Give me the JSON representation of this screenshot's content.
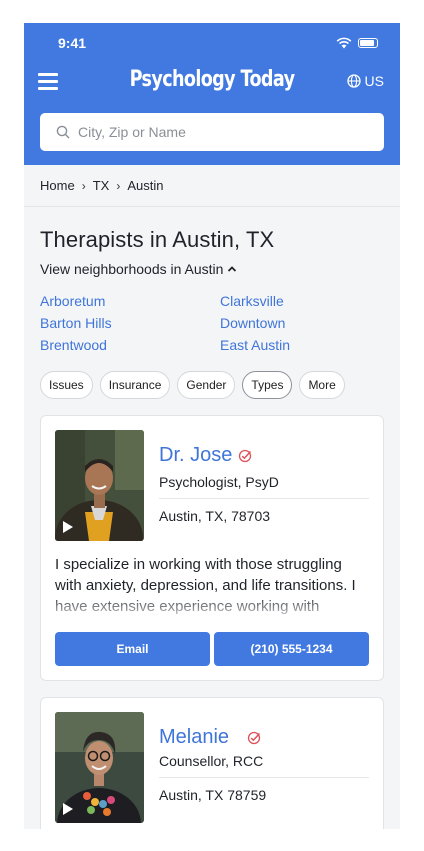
{
  "status_bar": {
    "time": "9:41"
  },
  "header": {
    "logo": "Psychology Today",
    "locale": "US",
    "search_placeholder": "City, Zip or Name"
  },
  "breadcrumb": [
    "Home",
    "TX",
    "Austin"
  ],
  "page": {
    "title": "Therapists in Austin, TX",
    "neighborhood_toggle": "View neighborhoods in Austin"
  },
  "neighborhoods": [
    "Arboretum",
    "Clarksville",
    "Barton Hills",
    "Downtown",
    "Brentwood",
    "East Austin"
  ],
  "filters": [
    "Issues",
    "Insurance",
    "Gender",
    "Types",
    "More"
  ],
  "active_filter": "Types",
  "therapists": [
    {
      "name": "Dr. Jose",
      "credential": "Psychologist, PsyD",
      "location": "Austin, TX, 78703",
      "blurb": "I specialize in working with those struggling with anxiety, depression, and life transitions. I have extensive experience working with",
      "email_label": "Email",
      "phone": "(210) 555-1234"
    },
    {
      "name": "Melanie",
      "credential": "Counsellor, RCC",
      "location": "Austin, TX 78759"
    }
  ],
  "colors": {
    "brand": "#4179e0",
    "link": "#3f75d8",
    "verified": "#e0525b"
  }
}
